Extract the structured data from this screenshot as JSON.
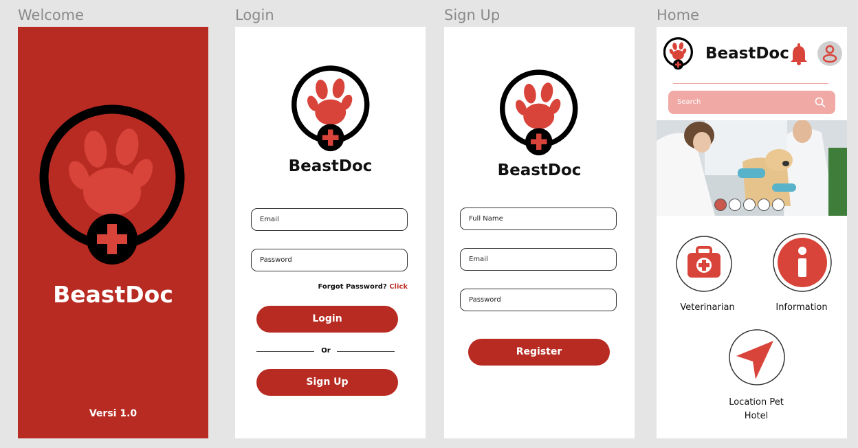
{
  "frames": {
    "welcome": {
      "label": "Welcome",
      "app_name": "BeastDoc",
      "version": "Versi 1.0"
    },
    "login": {
      "label": "Login",
      "app_name": "BeastDoc",
      "email_placeholder": "Email",
      "password_placeholder": "Password",
      "forgot_text": "Forgot Password?",
      "forgot_link": "Click",
      "login_button": "Login",
      "or_text": "Or",
      "signup_button": "Sign Up"
    },
    "signup": {
      "label": "Sign Up",
      "app_name": "BeastDoc",
      "fullname_placeholder": "Full Name",
      "email_placeholder": "Email",
      "password_placeholder": "Password",
      "register_button": "Register"
    },
    "home": {
      "label": "Home",
      "app_name": "BeastDoc",
      "search_placeholder": "Search",
      "carousel_active_index": 0,
      "carousel_count": 5,
      "menu": {
        "veterinarian": "Veterinarian",
        "information": "Information",
        "location_line1": "Location Pet",
        "location_line2": "Hotel"
      }
    }
  },
  "colors": {
    "brand": "#b82b22",
    "paw": "#d9443a",
    "search_bg": "#f0a9a5"
  },
  "icons": [
    "paw-logo-icon",
    "bell-icon",
    "user-icon",
    "search-icon",
    "medical-kit-icon",
    "info-icon",
    "location-arrow-icon"
  ]
}
